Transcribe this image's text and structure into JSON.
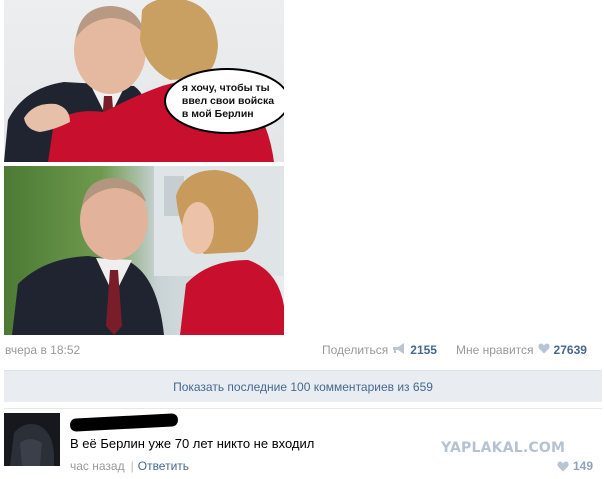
{
  "post": {
    "speech_bubble": "я хочу, чтобы ты\nввел свои войска\nв мой Берлин",
    "time": "вчера в 18:52",
    "share_label": "Поделиться",
    "share_count": "2155",
    "like_label": "Мне нравится",
    "like_count": "27639"
  },
  "comments_bar": {
    "label": "Показать последние 100 комментариев из 659"
  },
  "comment": {
    "text": "В её Берлин уже 70 лет никто не входил",
    "time": "час назад",
    "reply_label": "Ответить",
    "like_count": "149"
  },
  "watermark": "YAPLAKAL.COM",
  "colors": {
    "link": "#45688e",
    "meta": "#999999",
    "bar_bg": "#e9edf1",
    "coat_red": "#c8102e"
  },
  "icons": [
    "megaphone-icon",
    "heart-icon"
  ]
}
